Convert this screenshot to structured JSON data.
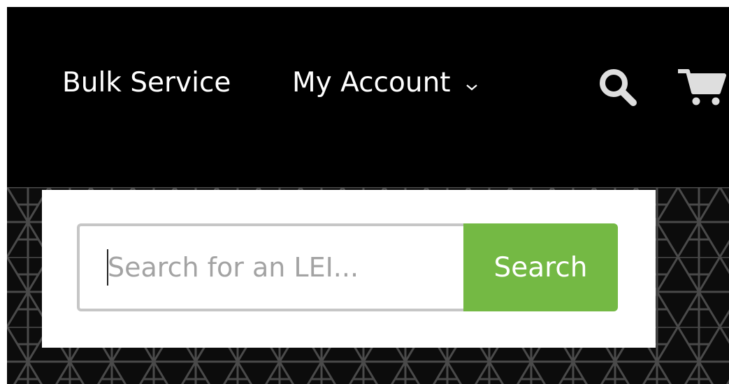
{
  "header": {
    "nav": {
      "bulk_service": "Bulk Service",
      "my_account": "My Account"
    },
    "icons": {
      "account_dropdown": "chevron-down-icon",
      "search": "search-icon",
      "cart": "cart-icon"
    }
  },
  "search": {
    "placeholder": "Search for an LEI...",
    "value": "",
    "button_label": "Search"
  },
  "colors": {
    "header_background": "#000000",
    "nav_text": "#ffffff",
    "nav_icons": "#dedede",
    "search_button": "#74b944",
    "input_border": "#c6c6c6",
    "placeholder": "#a3a3a3",
    "pattern_lines": "#4a4a4a"
  }
}
